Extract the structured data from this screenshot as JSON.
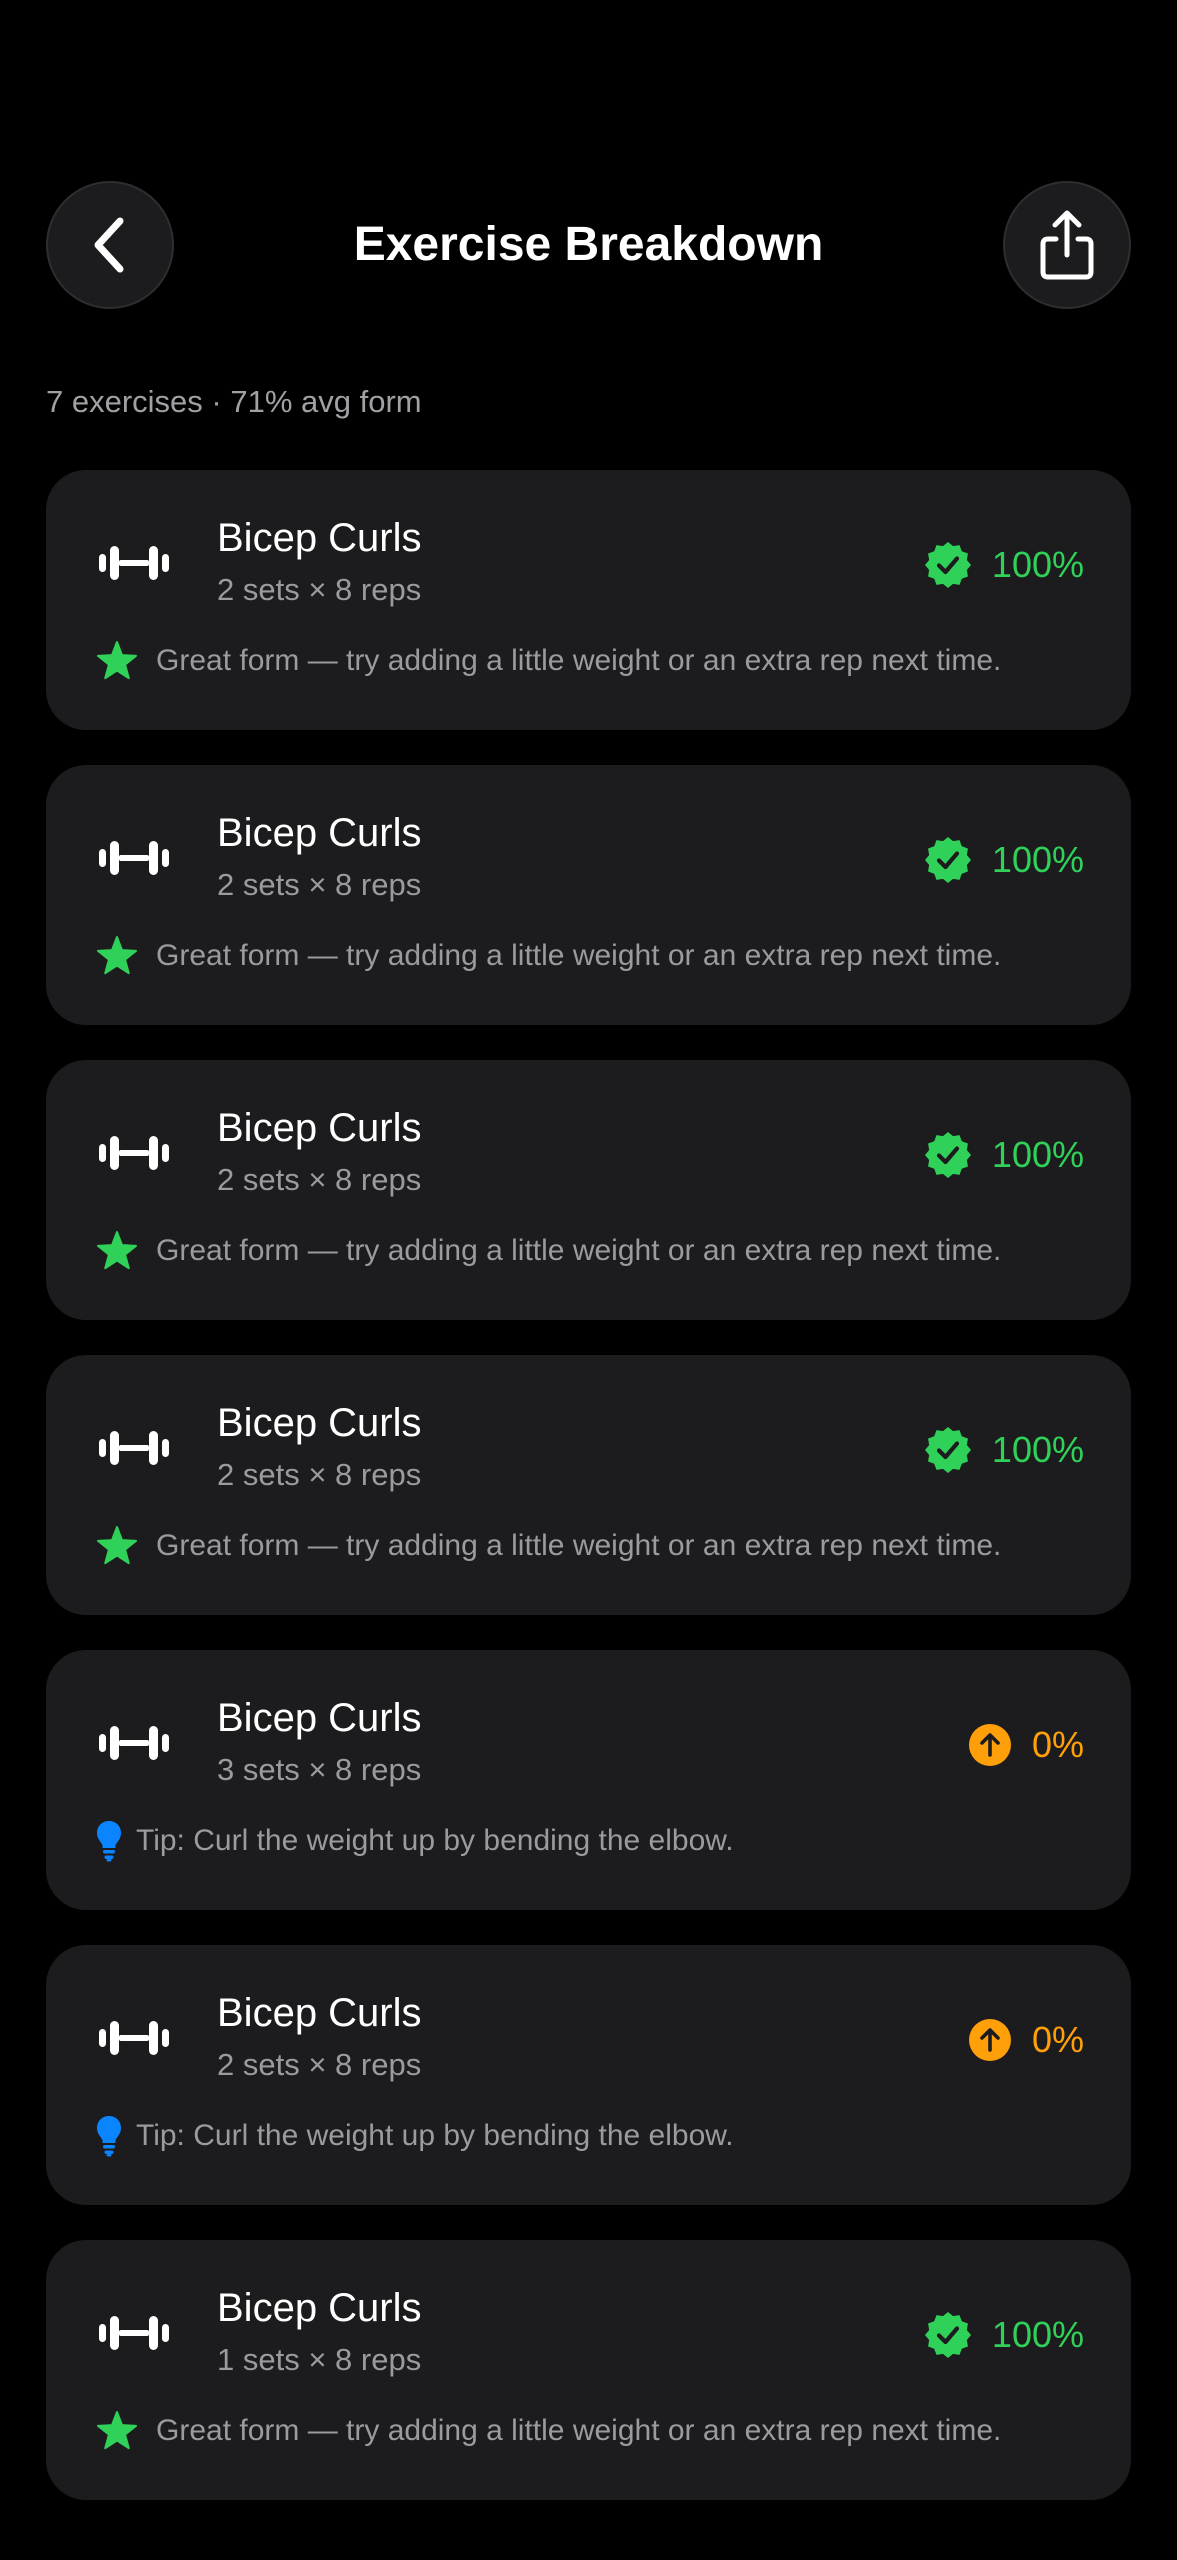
{
  "header": {
    "title": "Exercise Breakdown",
    "back_icon": "chevron-left-icon",
    "share_icon": "share-icon"
  },
  "summary": "7 exercises · 71% avg form",
  "colors": {
    "good": "#30d158",
    "needs_work": "#ff9f0a",
    "tip": "#0a84ff",
    "card": "#1c1c1e"
  },
  "exercises": [
    {
      "name": "Bicep Curls",
      "meta": "2 sets × 8 reps",
      "score": "100%",
      "status": "good",
      "note": "Great form — try adding a little weight or an extra rep next time."
    },
    {
      "name": "Bicep Curls",
      "meta": "2 sets × 8 reps",
      "score": "100%",
      "status": "good",
      "note": "Great form — try adding a little weight or an extra rep next time."
    },
    {
      "name": "Bicep Curls",
      "meta": "2 sets × 8 reps",
      "score": "100%",
      "status": "good",
      "note": "Great form — try adding a little weight or an extra rep next time."
    },
    {
      "name": "Bicep Curls",
      "meta": "2 sets × 8 reps",
      "score": "100%",
      "status": "good",
      "note": "Great form — try adding a little weight or an extra rep next time."
    },
    {
      "name": "Bicep Curls",
      "meta": "3 sets × 8 reps",
      "score": "0%",
      "status": "needs_work",
      "note": "Tip: Curl the weight up by bending the elbow."
    },
    {
      "name": "Bicep Curls",
      "meta": "2 sets × 8 reps",
      "score": "0%",
      "status": "needs_work",
      "note": "Tip: Curl the weight up by bending the elbow."
    },
    {
      "name": "Bicep Curls",
      "meta": "1 sets × 8 reps",
      "score": "100%",
      "status": "good",
      "note": "Great form — try adding a little weight or an extra rep next time."
    }
  ]
}
